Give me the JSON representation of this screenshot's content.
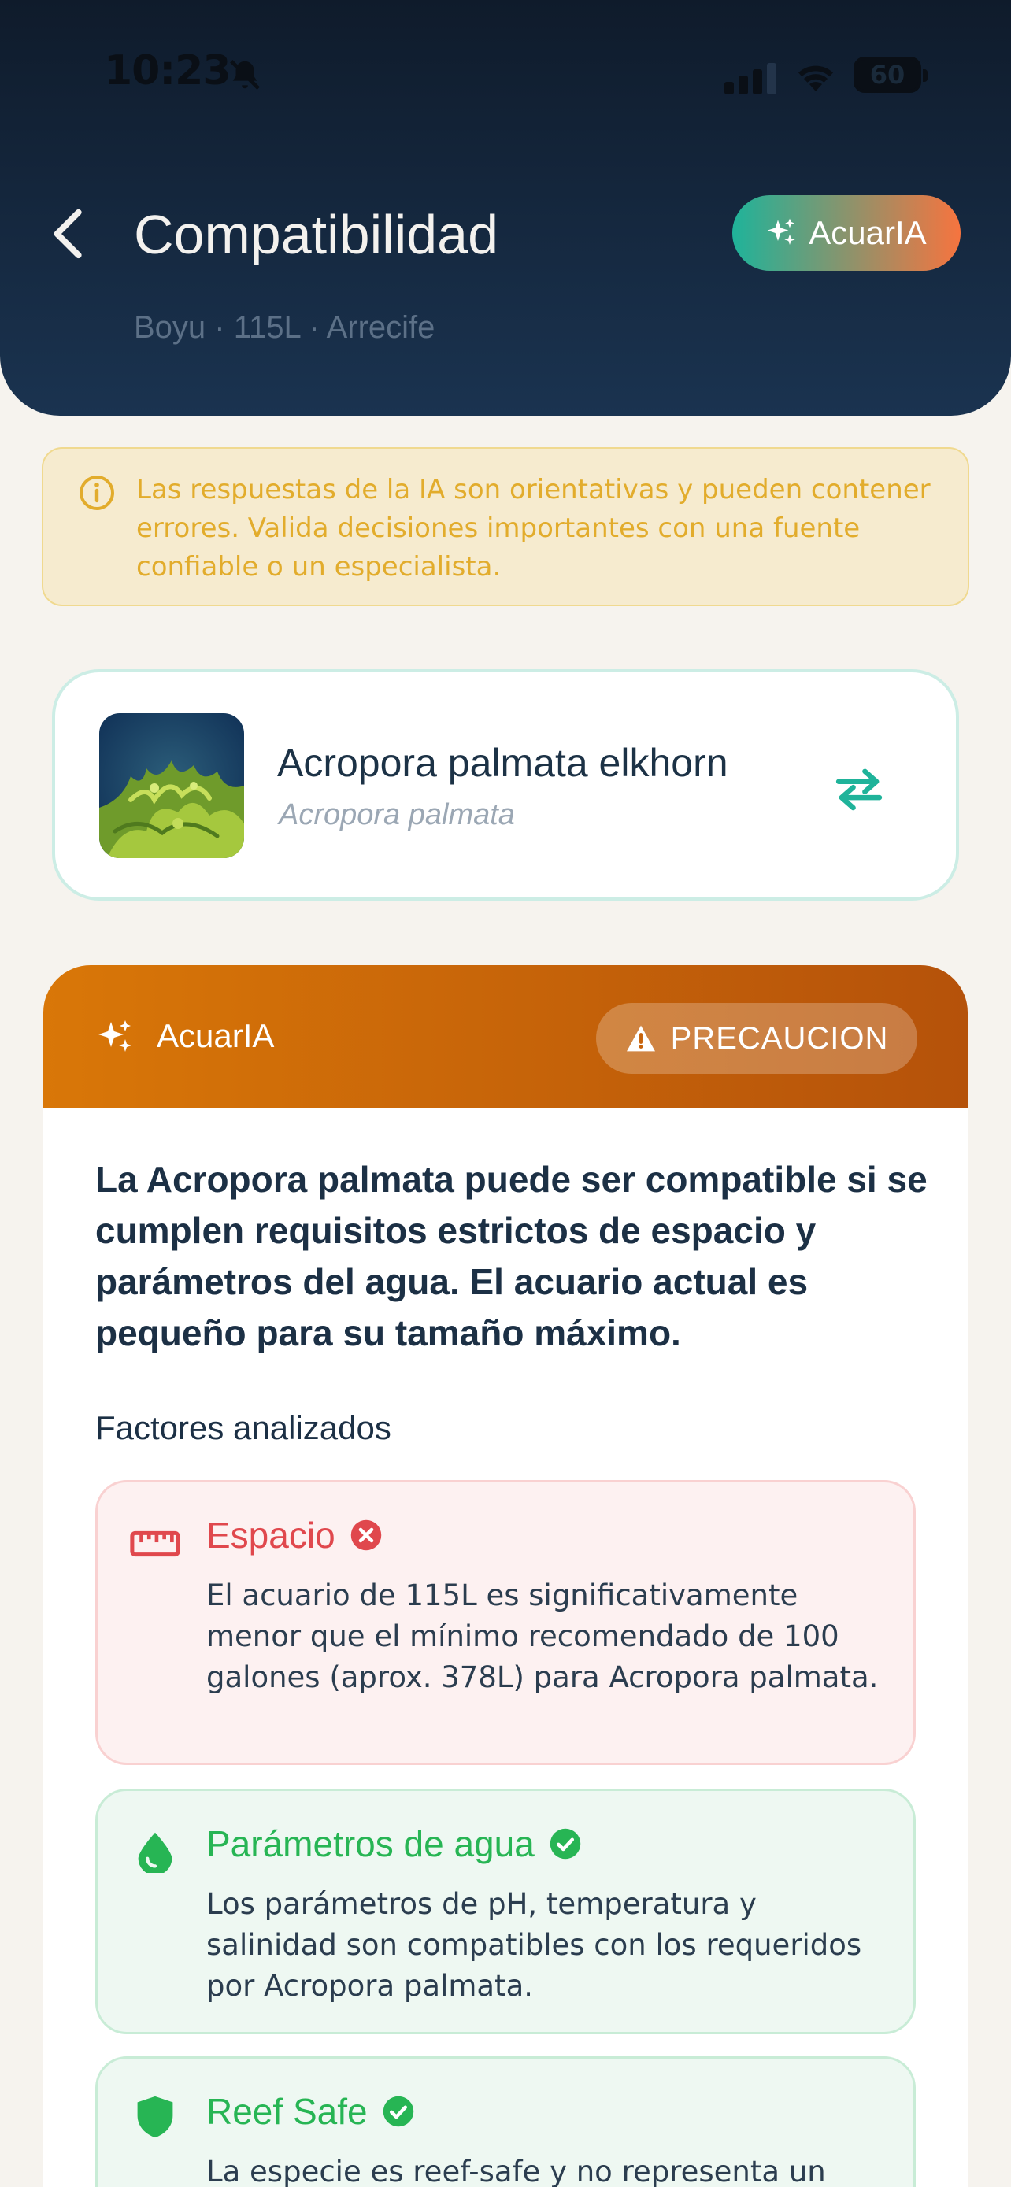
{
  "status_bar": {
    "time": "10:23",
    "battery": "60",
    "icons": [
      "bell-slash-icon",
      "cellular-signal-icon",
      "wifi-icon",
      "battery-icon"
    ]
  },
  "header": {
    "title": "Compatibilidad",
    "subtitle": "Boyu · 115L · Arrecife",
    "ai_button_label": "AcuarIA",
    "back_icon": "chevron-left-icon"
  },
  "disclaimer": {
    "text": "Las respuestas de la IA son orientativas y pueden contener errores. Valida decisiones importantes con una fuente confiable o un especialista.",
    "icon": "info-icon",
    "color": "#e2ac2c"
  },
  "species": {
    "common_name": "Acropora palmata elkhorn",
    "scientific_name": "Acropora palmata",
    "swap_icon": "swap-icon"
  },
  "result": {
    "title": "AcuarIA",
    "verdict": "PRECAUCION",
    "verdict_color": "#d97708",
    "summary": "La Acropora palmata puede ser compatible si se cumplen requisitos estrictos de espacio y parámetros del agua. El acuario actual es pequeño para su tamaño máximo.",
    "factors_title": "Factores analizados",
    "factors": [
      {
        "title": "Espacio",
        "status": "fail",
        "icon": "ruler-icon",
        "description": "El acuario de 115L es significativamente menor que el mínimo recomendado de 100 galones (aprox. 378L) para Acropora palmata."
      },
      {
        "title": "Parámetros de agua",
        "status": "pass",
        "icon": "water-drop-icon",
        "description": "Los parámetros de pH, temperatura y salinidad son compatibles con los requeridos por Acropora palmata."
      },
      {
        "title": "Reef Safe",
        "status": "pass",
        "icon": "shield-icon",
        "description": "La especie es reef-safe y no representa un"
      }
    ]
  },
  "colors": {
    "accent_teal": "#1fb39a",
    "accent_orange": "#f6743f",
    "fail": "#e0484d",
    "pass": "#27b554",
    "header_bg": "#1a3350"
  }
}
